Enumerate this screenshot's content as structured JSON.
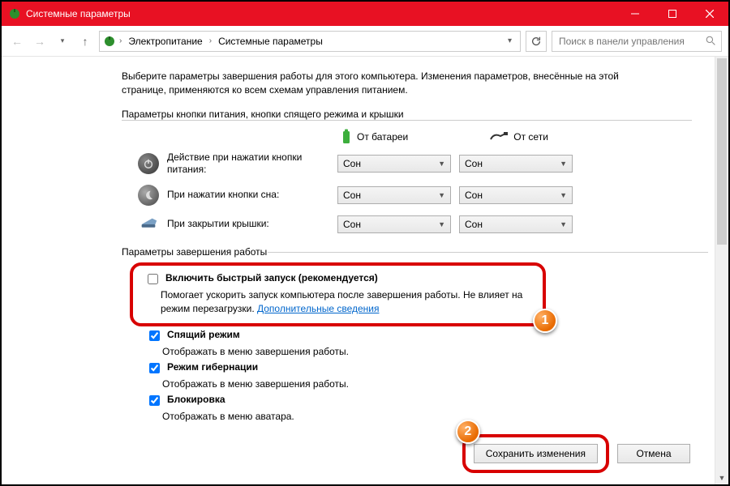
{
  "window": {
    "title": "Системные параметры"
  },
  "breadcrumb": {
    "item1": "Электропитание",
    "item2": "Системные параметры"
  },
  "search": {
    "placeholder": "Поиск в панели управления"
  },
  "intro": "Выберите параметры завершения работы для этого компьютера. Изменения параметров, внесённые на этой странице, применяются ко всем схемам управления питанием.",
  "section1_title": "Параметры кнопки питания, кнопки спящего режима и крышки",
  "columns": {
    "battery": "От батареи",
    "ac": "От сети"
  },
  "rows": {
    "power_btn": {
      "label": "Действие при нажатии кнопки питания:",
      "battery": "Сон",
      "ac": "Сон"
    },
    "sleep_btn": {
      "label": "При нажатии кнопки сна:",
      "battery": "Сон",
      "ac": "Сон"
    },
    "lid": {
      "label": "При закрытии крышки:",
      "battery": "Сон",
      "ac": "Сон"
    }
  },
  "section2_title": "Параметры завершения работы",
  "shutdown": {
    "fast_startup": {
      "label": "Включить быстрый запуск (рекомендуется)",
      "desc_prefix": "Помогает ускорить запуск компьютера после завершения работы. Не влияет на режим перезагрузки. ",
      "link": "Дополнительные сведения"
    },
    "sleep": {
      "label": "Спящий режим",
      "desc": "Отображать в меню завершения работы."
    },
    "hibernate": {
      "label": "Режим гибернации",
      "desc": "Отображать в меню завершения работы."
    },
    "lock": {
      "label": "Блокировка",
      "desc": "Отображать в меню аватара."
    }
  },
  "buttons": {
    "save": "Сохранить изменения",
    "cancel": "Отмена"
  },
  "badges": {
    "one": "1",
    "two": "2"
  }
}
